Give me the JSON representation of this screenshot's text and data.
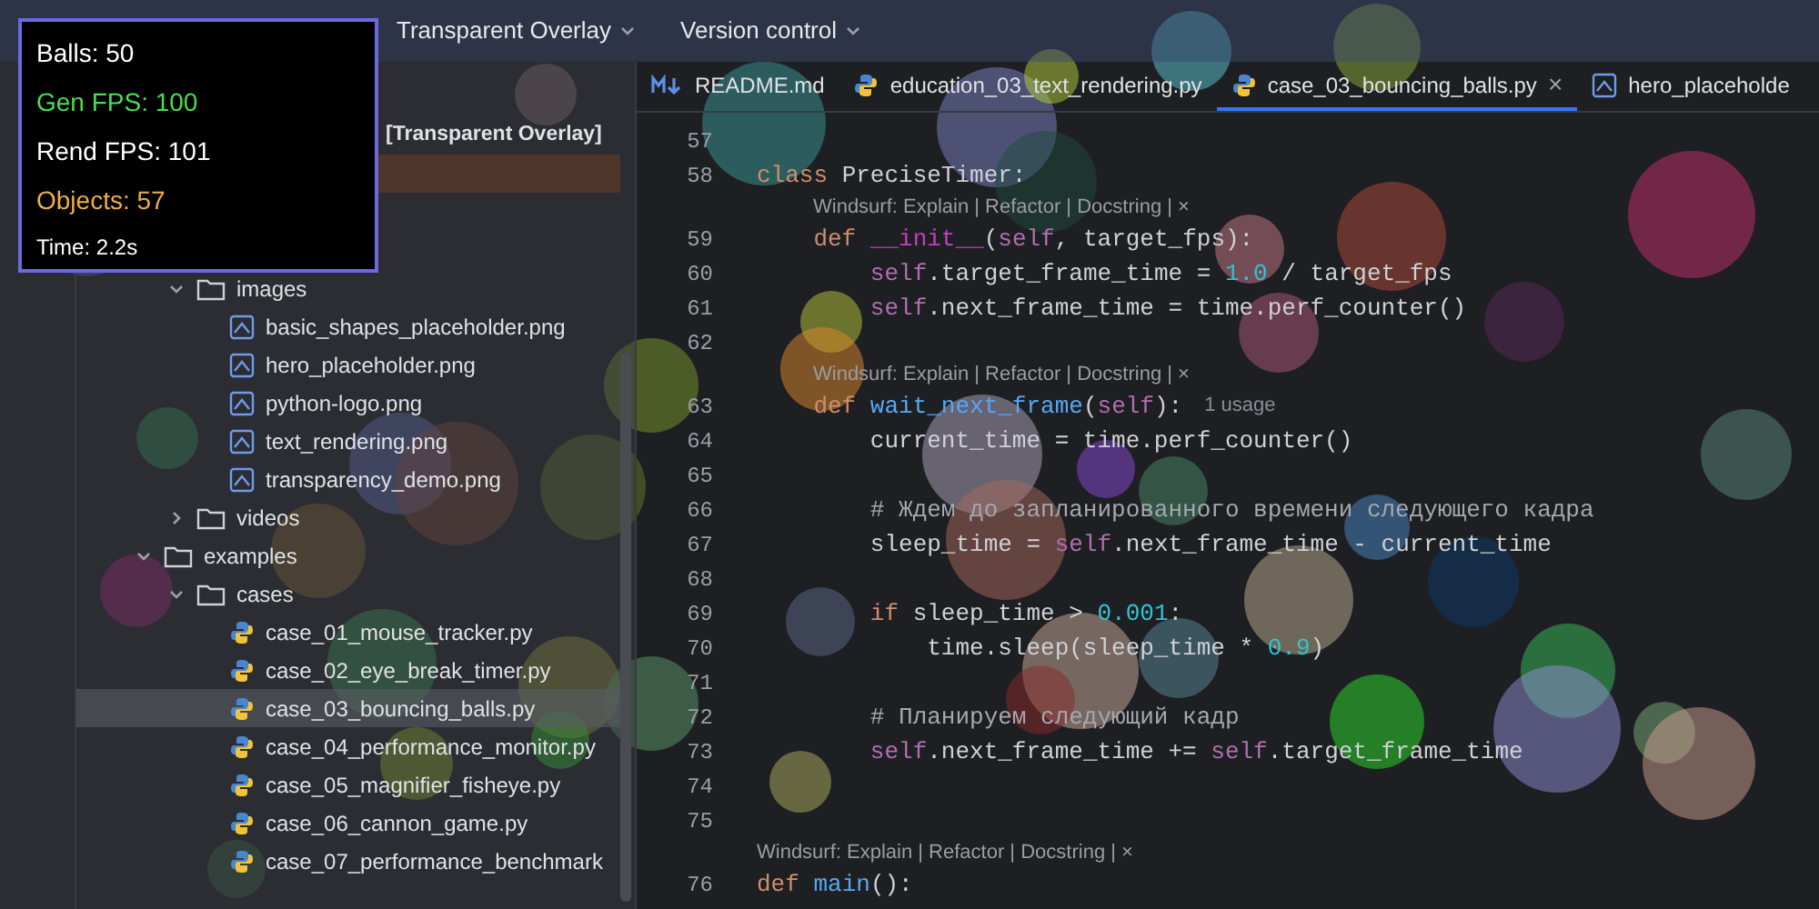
{
  "header": {
    "project": "Transparent Overlay",
    "vcs": "Version control"
  },
  "stats": [
    {
      "kind": "plain",
      "text": "Balls: 50"
    },
    {
      "kind": "good",
      "text": "Gen FPS: 100"
    },
    {
      "kind": "plain",
      "text": "Rend FPS: 101"
    },
    {
      "kind": "warn",
      "text": "Objects: 57"
    },
    {
      "kind": "small",
      "text": "Time: 2.2s"
    }
  ],
  "tree": [
    {
      "label": "[Transparent Overlay]",
      "kind": "root",
      "selected": false,
      "children": [
        {
          "kind": "excluded",
          "selected": false
        },
        {
          "kind": "folder",
          "selected": false,
          "children": [
            {
              "kind": "folder",
              "selected": false
            },
            {
              "label": "images",
              "kind": "folder",
              "expanded": true,
              "selected": false,
              "children": [
                {
                  "label": "basic_shapes_placeholder.png",
                  "kind": "image",
                  "selected": false
                },
                {
                  "label": "hero_placeholder.png",
                  "kind": "image",
                  "selected": false
                },
                {
                  "label": "python-logo.png",
                  "kind": "image",
                  "selected": false
                },
                {
                  "label": "text_rendering.png",
                  "kind": "image",
                  "selected": false
                },
                {
                  "label": "transparency_demo.png",
                  "kind": "image",
                  "selected": false
                }
              ]
            },
            {
              "label": "videos",
              "kind": "folder",
              "expanded": false,
              "selected": false
            }
          ]
        },
        {
          "label": "examples",
          "kind": "folder",
          "expanded": true,
          "selected": false,
          "children": [
            {
              "label": "cases",
              "kind": "folder",
              "expanded": true,
              "selected": false,
              "children": [
                {
                  "label": "case_01_mouse_tracker.py",
                  "kind": "python",
                  "selected": false
                },
                {
                  "label": "case_02_eye_break_timer.py",
                  "kind": "python",
                  "selected": false
                },
                {
                  "label": "case_03_bouncing_balls.py",
                  "kind": "python",
                  "selected": true
                },
                {
                  "label": "case_04_performance_monitor.py",
                  "kind": "python",
                  "selected": false
                },
                {
                  "label": "case_05_magnifier_fisheye.py",
                  "kind": "python",
                  "selected": false
                },
                {
                  "label": "case_06_cannon_game.py",
                  "kind": "python",
                  "selected": false
                },
                {
                  "label": "case_07_performance_benchmark",
                  "kind": "python",
                  "selected": false
                }
              ]
            }
          ]
        }
      ]
    }
  ],
  "tabs": [
    {
      "label": "README.md",
      "kind": "markdown",
      "selected": false
    },
    {
      "label": "education_03_text_rendering.py",
      "kind": "python",
      "selected": false
    },
    {
      "label": "case_03_bouncing_balls.py",
      "kind": "python",
      "selected": true,
      "close": "×"
    },
    {
      "label": "hero_placeholde",
      "kind": "image",
      "selected": false
    }
  ],
  "lines": [
    {
      "kind": "code",
      "number": "57"
    },
    {
      "kind": "code",
      "number": "58",
      "tokens": [
        {
          "kind": "kw",
          "t": "class "
        },
        {
          "kind": "plain",
          "t": "PreciseTimer:"
        }
      ]
    },
    {
      "kind": "lens",
      "text": "Windsurf: Explain | Refactor | Docstring | ×"
    },
    {
      "kind": "code",
      "number": "59",
      "tokens": [
        {
          "kind": "kw",
          "t": "    def "
        },
        {
          "kind": "dunder",
          "t": "__init__"
        },
        {
          "kind": "plain",
          "t": "("
        },
        {
          "kind": "self",
          "t": "self"
        },
        {
          "kind": "plain",
          "t": ", target_fps):"
        }
      ]
    },
    {
      "kind": "code",
      "number": "60",
      "tokens": [
        {
          "kind": "self",
          "t": "        self"
        },
        {
          "kind": "plain",
          "t": ".target_frame_time = "
        },
        {
          "kind": "num",
          "t": "1.0"
        },
        {
          "kind": "plain",
          "t": " / target_fps"
        }
      ]
    },
    {
      "kind": "code",
      "number": "61",
      "tokens": [
        {
          "kind": "self",
          "t": "        self"
        },
        {
          "kind": "plain",
          "t": ".next_frame_time = time.perf_counter()"
        }
      ]
    },
    {
      "kind": "code",
      "number": "62"
    },
    {
      "kind": "lens",
      "text": "Windsurf: Explain | Refactor | Docstring | ×"
    },
    {
      "kind": "code",
      "number": "63",
      "tokens": [
        {
          "kind": "kw",
          "t": "    def "
        },
        {
          "kind": "fn",
          "t": "wait_next_frame"
        },
        {
          "kind": "plain",
          "t": "("
        },
        {
          "kind": "self",
          "t": "self"
        },
        {
          "kind": "plain",
          "t": "):"
        }
      ],
      "hint": "1 usage"
    },
    {
      "kind": "code",
      "number": "64",
      "tokens": [
        {
          "kind": "plain",
          "t": "        current_time = time.perf_counter()"
        }
      ]
    },
    {
      "kind": "code",
      "number": "65"
    },
    {
      "kind": "code",
      "number": "66",
      "tokens": [
        {
          "kind": "comment",
          "t": "        # Ждем до запланированного времени следующего кадра"
        }
      ]
    },
    {
      "kind": "code",
      "number": "67",
      "tokens": [
        {
          "kind": "plain",
          "t": "        sleep_time = "
        },
        {
          "kind": "self",
          "t": "self"
        },
        {
          "kind": "plain",
          "t": ".next_frame_time - current_time"
        }
      ]
    },
    {
      "kind": "code",
      "number": "68"
    },
    {
      "kind": "code",
      "number": "69",
      "tokens": [
        {
          "kind": "kw",
          "t": "        if "
        },
        {
          "kind": "plain",
          "t": "sleep_time > "
        },
        {
          "kind": "num",
          "t": "0.001"
        },
        {
          "kind": "plain",
          "t": ":"
        }
      ]
    },
    {
      "kind": "code",
      "number": "70",
      "tokens": [
        {
          "kind": "plain",
          "t": "            time.sleep(sleep_time * "
        },
        {
          "kind": "num",
          "t": "0.9"
        },
        {
          "kind": "plain",
          "t": ")"
        }
      ]
    },
    {
      "kind": "code",
      "number": "71"
    },
    {
      "kind": "code",
      "number": "72",
      "tokens": [
        {
          "kind": "comment",
          "t": "        # Планируем следующий кадр"
        }
      ]
    },
    {
      "kind": "code",
      "number": "73",
      "tokens": [
        {
          "kind": "self",
          "t": "        self"
        },
        {
          "kind": "plain",
          "t": ".next_frame_time += "
        },
        {
          "kind": "self",
          "t": "self"
        },
        {
          "kind": "plain",
          "t": ".target_frame_time"
        }
      ]
    },
    {
      "kind": "code",
      "number": "74"
    },
    {
      "kind": "code",
      "number": "75"
    },
    {
      "kind": "lens-top",
      "text": "Windsurf: Explain | Refactor | Docstring | ×"
    },
    {
      "kind": "code",
      "number": "76",
      "tokens": [
        {
          "kind": "kw",
          "t": "def "
        },
        {
          "kind": "fn",
          "t": "main"
        },
        {
          "kind": "plain",
          "t": "():"
        }
      ]
    }
  ]
}
